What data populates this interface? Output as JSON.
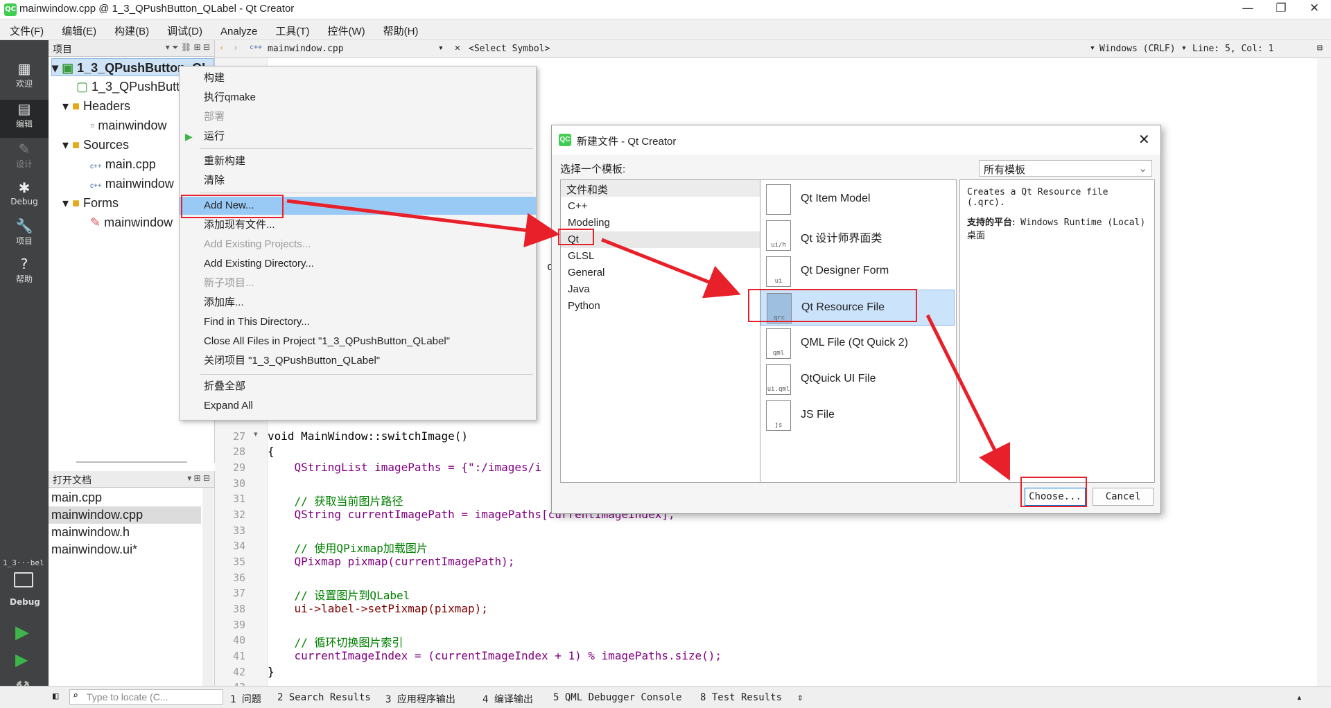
{
  "window": {
    "title": "mainwindow.cpp @ 1_3_QPushButton_QLabel - Qt Creator",
    "logo": "QC",
    "controls": {
      "min": "—",
      "max": "❐",
      "close": "✕"
    }
  },
  "menu": [
    "文件(F)",
    "编辑(E)",
    "构建(B)",
    "调试(D)",
    "Analyze",
    "工具(T)",
    "控件(W)",
    "帮助(H)"
  ],
  "modes": [
    {
      "label": "欢迎",
      "icon": "grid-icon",
      "glyph": "▦"
    },
    {
      "label": "编辑",
      "icon": "edit-icon",
      "glyph": "▤"
    },
    {
      "label": "设计",
      "icon": "pencil-icon",
      "glyph": "✎"
    },
    {
      "label": "Debug",
      "icon": "bug-icon",
      "glyph": "✱"
    },
    {
      "label": "项目",
      "icon": "wrench-icon",
      "glyph": "🔧"
    },
    {
      "label": "帮助",
      "icon": "help-icon",
      "glyph": "?"
    }
  ],
  "kit": {
    "project": "1_3···bel",
    "config": "Debug"
  },
  "project_pane": {
    "header": "项目",
    "tree": [
      {
        "text": "1_3_QPushButton_QL",
        "arrow": "▾"
      },
      {
        "text": "1_3_QPushButt",
        "arrow": ""
      },
      {
        "text": "Headers",
        "arrow": "▾"
      },
      {
        "text": "mainwindow",
        "arrow": ""
      },
      {
        "text": "Sources",
        "arrow": "▾"
      },
      {
        "text": "main.cpp",
        "arrow": ""
      },
      {
        "text": "mainwindow",
        "arrow": ""
      },
      {
        "text": "Forms",
        "arrow": "▾"
      },
      {
        "text": "mainwindow",
        "arrow": ""
      }
    ]
  },
  "open_docs": {
    "header": "打开文档",
    "items": [
      "main.cpp",
      "mainwindow.cpp",
      "mainwindow.h",
      "mainwindow.ui*"
    ]
  },
  "editor": {
    "file": "mainwindow.cpp",
    "symbol": "<Select Symbol>",
    "encoding": "Windows (CRLF)",
    "position": "Line: 5, Col: 1",
    "partial_fragment": "on:",
    "line_numbers": [
      "27",
      "28",
      "29",
      "30",
      "31",
      "32",
      "33",
      "34",
      "35",
      "36",
      "37",
      "38",
      "39",
      "40",
      "41",
      "42",
      "43"
    ],
    "lines": [
      "void MainWindow::switchImage()",
      "{",
      "    QStringList imagePaths = {\":/images/i",
      "",
      "    // 获取当前图片路径",
      "    QString currentImagePath = imagePaths[currentImageIndex];",
      "",
      "    // 使用QPixmap加载图片",
      "    QPixmap pixmap(currentImagePath);",
      "",
      "    // 设置图片到QLabel",
      "    ui->label->setPixmap(pixmap);",
      "",
      "    // 循环切换图片索引",
      "    currentImageIndex = (currentImageIndex + 1) % imagePaths.size();",
      "}",
      ""
    ]
  },
  "context_menu": [
    {
      "label": "构建",
      "state": "normal"
    },
    {
      "label": "执行qmake",
      "state": "normal"
    },
    {
      "label": "部署",
      "state": "disabled"
    },
    {
      "label": "运行",
      "state": "normal"
    },
    {
      "label": "重新构建",
      "state": "normal"
    },
    {
      "label": "清除",
      "state": "normal"
    },
    {
      "label": "Add New...",
      "state": "highlighted"
    },
    {
      "label": "添加现有文件...",
      "state": "normal"
    },
    {
      "label": "Add Existing Projects...",
      "state": "disabled"
    },
    {
      "label": "Add Existing Directory...",
      "state": "normal"
    },
    {
      "label": "新子项目...",
      "state": "disabled"
    },
    {
      "label": "添加库...",
      "state": "normal"
    },
    {
      "label": "Find in This Directory...",
      "state": "normal"
    },
    {
      "label": "Close All Files in Project \"1_3_QPushButton_QLabel\"",
      "state": "normal"
    },
    {
      "label": "关闭项目 \"1_3_QPushButton_QLabel\"",
      "state": "normal"
    },
    {
      "label": "折叠全部",
      "state": "normal"
    },
    {
      "label": "Expand All",
      "state": "normal"
    }
  ],
  "dialog": {
    "title": "新建文件 - Qt Creator",
    "prompt": "选择一个模板:",
    "filter": "所有模板",
    "categories_header": "文件和类",
    "categories": [
      "C++",
      "Modeling",
      "Qt",
      "GLSL",
      "General",
      "Java",
      "Python"
    ],
    "selected_category": "Qt",
    "templates": [
      {
        "name": "Qt Item Model",
        "tag": ""
      },
      {
        "name": "Qt 设计师界面类",
        "tag": "ui/h"
      },
      {
        "name": "Qt Designer Form",
        "tag": "ui"
      },
      {
        "name": "Qt Resource File",
        "tag": "qrc"
      },
      {
        "name": "QML File (Qt Quick 2)",
        "tag": "qml"
      },
      {
        "name": "QtQuick UI File",
        "tag": "ui.qml"
      },
      {
        "name": "JS File",
        "tag": "js"
      }
    ],
    "selected_template": "Qt Resource File",
    "description": "Creates a Qt Resource file (.qrc).",
    "platforms_label": "支持的平台:",
    "platforms": "Windows Runtime (Local) 桌面",
    "choose": "Choose...",
    "cancel": "Cancel"
  },
  "status": {
    "locator_placeholder": "Type to locate (C...",
    "tabs": [
      "1 问题",
      "2 Search Results",
      "3 应用程序输出",
      "4 编译输出",
      "5 QML Debugger Console",
      "8 Test Results"
    ]
  },
  "annotation_color": "#e8202a"
}
